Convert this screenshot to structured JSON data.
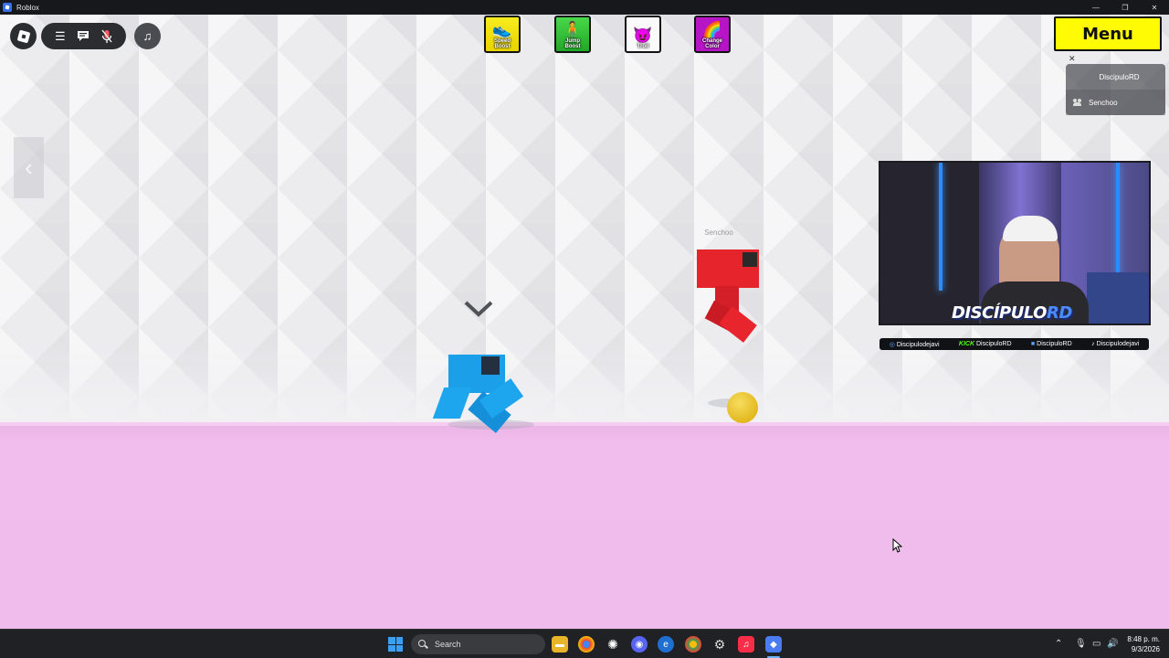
{
  "window": {
    "title": "Roblox",
    "controls": [
      "minimize",
      "restore",
      "close"
    ]
  },
  "hud": {
    "menu_label": "Menu",
    "music_icon": "♫",
    "powerups": [
      {
        "id": "speed",
        "label": "Speed\nBoost"
      },
      {
        "id": "jump",
        "label": "Jump\nBoost"
      },
      {
        "id": "troll",
        "label": "Troll"
      },
      {
        "id": "color",
        "label": "Change\nColor"
      }
    ]
  },
  "players": {
    "list": [
      "DiscipuloRD",
      "Senchoo"
    ]
  },
  "game": {
    "other_player_name": "Senchoo",
    "colors": {
      "floor": "#efbcec",
      "blue_player": "#1a9fe8",
      "red_player": "#e6242c",
      "coin": "#e2b91f"
    }
  },
  "webcam": {
    "brand_prefix": "DISCÍPULO",
    "brand_suffix": "RD",
    "socials": [
      {
        "icon": "instagram-icon",
        "label": "Discipulodejavi"
      },
      {
        "icon": "kick-icon",
        "prefix": "KICK",
        "label": "DiscipuloRD"
      },
      {
        "icon": "twitch-icon",
        "label": "DiscipuloRD"
      },
      {
        "icon": "tiktok-icon",
        "label": "Discipulodejavi"
      }
    ]
  },
  "taskbar": {
    "search_label": "Search",
    "time": "8:48 p. m.",
    "date": "9/3/2026"
  }
}
